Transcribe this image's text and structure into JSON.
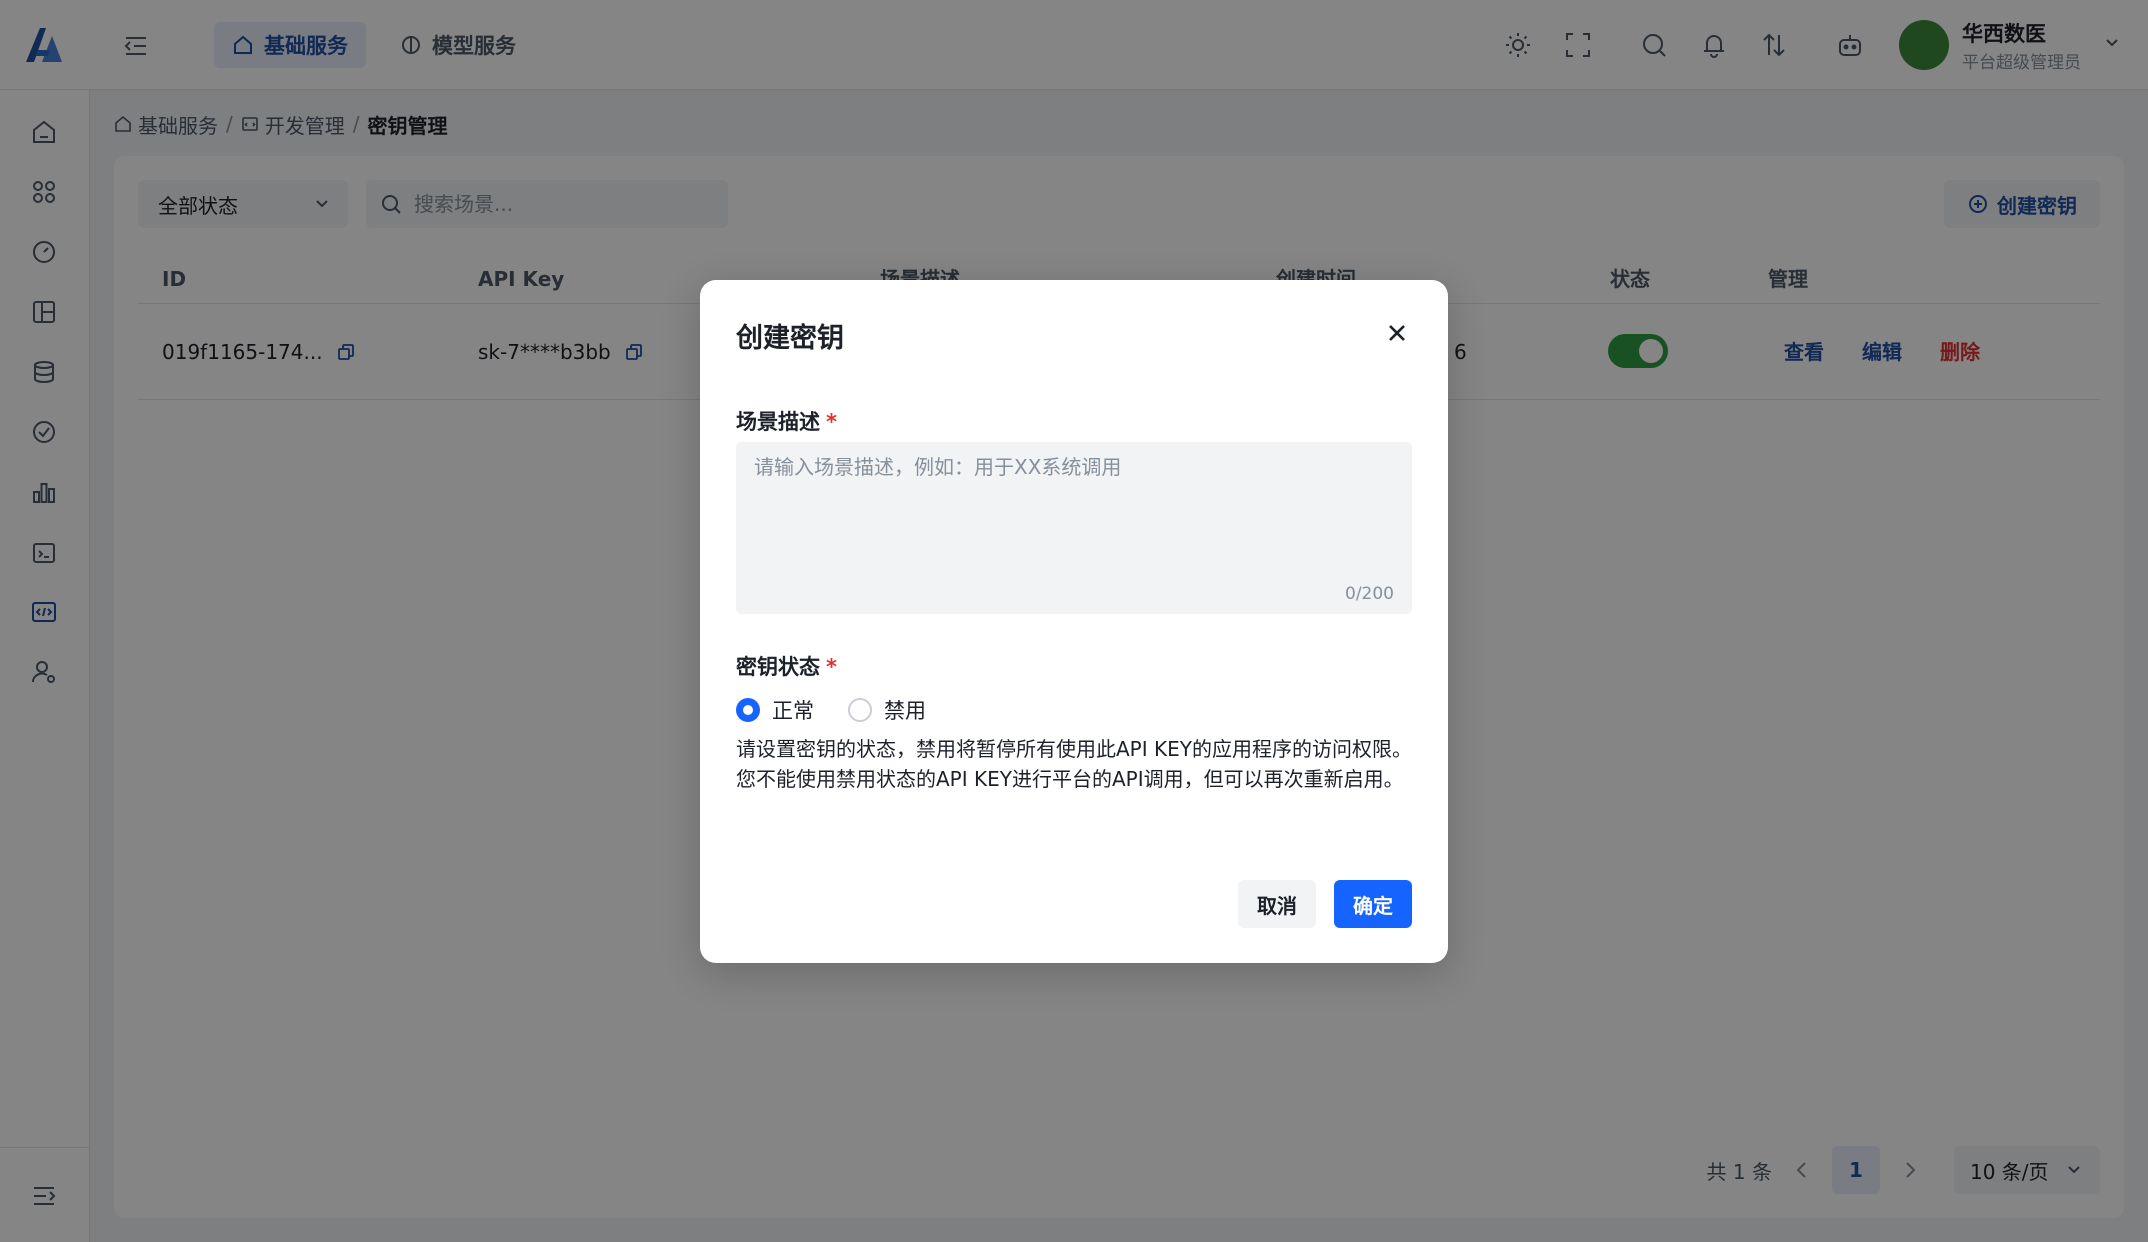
{
  "header": {
    "tabs": [
      {
        "label": "基础服务",
        "icon": "home-icon",
        "active": true
      },
      {
        "label": "模型服务",
        "icon": "brain-icon",
        "active": false
      }
    ],
    "icons": [
      "theme-icon",
      "fullscreen-icon",
      "search-icon",
      "bell-icon",
      "sort-icon",
      "robot-icon"
    ],
    "user": {
      "name": "华西数医",
      "role": "平台超级管理员"
    },
    "accent": "#1f4fa3"
  },
  "sidebar": {
    "items": [
      {
        "icon": "home-icon"
      },
      {
        "icon": "apps-icon"
      },
      {
        "icon": "dashboard-icon"
      },
      {
        "icon": "layout-icon"
      },
      {
        "icon": "database-icon"
      },
      {
        "icon": "check-icon"
      },
      {
        "icon": "chart-icon"
      },
      {
        "icon": "terminal-icon"
      },
      {
        "icon": "code-icon",
        "active": true
      },
      {
        "icon": "user-settings-icon"
      }
    ],
    "bottom_icon": "expand-icon"
  },
  "breadcrumb": {
    "items": [
      "基础服务",
      "开发管理"
    ],
    "current": "密钥管理"
  },
  "toolbar": {
    "status_filter": "全部状态",
    "search_placeholder": "搜索场景...",
    "create_label": "创建密钥"
  },
  "table": {
    "columns": [
      "ID",
      "API Key",
      "场景描述",
      "创建时间",
      "状态",
      "管理"
    ],
    "rows": [
      {
        "id": "019f1165-174...",
        "api_key": "sk-7****b3bb",
        "time_tail": "6",
        "enabled": true
      }
    ],
    "actions": {
      "view": "查看",
      "edit": "编辑",
      "delete": "删除"
    }
  },
  "pagination": {
    "total_text": "共 1 条",
    "current_page": "1",
    "page_size": "10 条/页"
  },
  "modal": {
    "title": "创建密钥",
    "desc_label": "场景描述",
    "desc_placeholder": "请输入场景描述，例如：用于XX系统调用",
    "desc_count": "0/200",
    "status_label": "密钥状态",
    "required_mark": "*",
    "options": {
      "normal": "正常",
      "disabled": "禁用"
    },
    "selected": "正常",
    "hint": "请设置密钥的状态，禁用将暂停所有使用此API KEY的应用程序的访问权限。您不能使用禁用状态的API KEY进行平台的API调用，但可以再次重新启用。",
    "cancel_label": "取消",
    "ok_label": "确定",
    "ok_color": "#1664ff"
  }
}
